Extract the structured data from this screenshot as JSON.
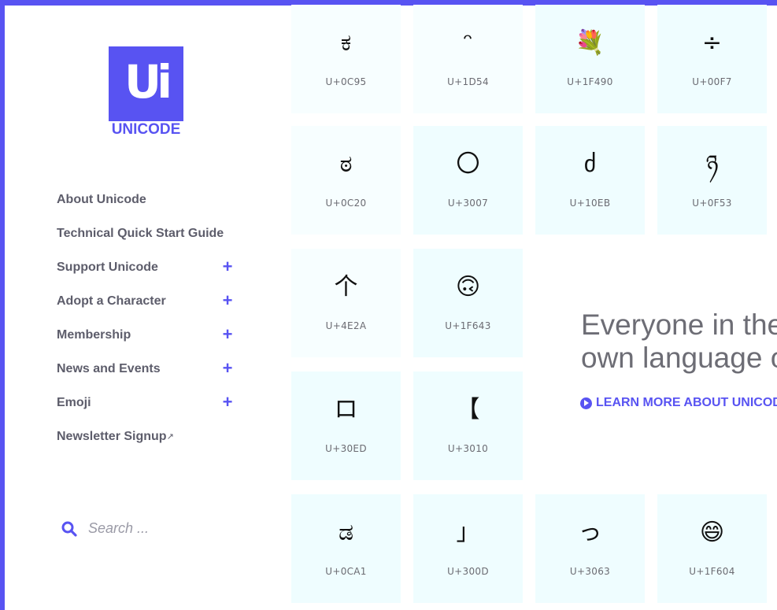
{
  "brand": {
    "name": "UNICODE",
    "logo_mark": "Ui",
    "accent_color": "#5853f2"
  },
  "nav": [
    {
      "label": "About Unicode",
      "expandable": false
    },
    {
      "label": "Technical Quick Start Guide",
      "expandable": false
    },
    {
      "label": "Support Unicode",
      "expandable": true,
      "expand_symbol": "+"
    },
    {
      "label": "Adopt a Character",
      "expandable": true,
      "expand_symbol": "+"
    },
    {
      "label": "Membership",
      "expandable": true,
      "expand_symbol": "+"
    },
    {
      "label": "News and Events",
      "expandable": true,
      "expand_symbol": "+"
    },
    {
      "label": "Emoji",
      "expandable": true,
      "expand_symbol": "+"
    },
    {
      "label": "Newsletter Signup",
      "expandable": false,
      "external_icon": "↗"
    }
  ],
  "search": {
    "placeholder": "Search ...",
    "icon": "search-icon"
  },
  "tiles": [
    {
      "glyph": "ಕ",
      "code": "U+0C95"
    },
    {
      "glyph": "ᵔ",
      "code": "U+1D54"
    },
    {
      "glyph": "💐",
      "code": "U+1F490"
    },
    {
      "glyph": "÷",
      "code": "U+00F7"
    },
    {
      "glyph": "ಠ",
      "code": "U+0C20"
    },
    {
      "glyph": "〇",
      "code": "U+3007"
    },
    {
      "glyph": "ძ",
      "code": "U+10EB"
    },
    {
      "glyph": "ཉ",
      "code": "U+0F53"
    },
    {
      "glyph": "个",
      "code": "U+4E2A"
    },
    {
      "glyph": "🙃",
      "code": "U+1F643"
    },
    {
      "glyph": "ロ",
      "code": "U+30ED"
    },
    {
      "glyph": "【",
      "code": "U+3010"
    },
    {
      "glyph": "ಡ",
      "code": "U+0CA1"
    },
    {
      "glyph": "」",
      "code": "U+300D"
    },
    {
      "glyph": "っ",
      "code": "U+3063"
    },
    {
      "glyph": "😄",
      "code": "U+1F604"
    }
  ],
  "hero": {
    "line1": "Everyone in the",
    "line2": "own language o",
    "cta_label": "LEARN MORE ABOUT UNICODE",
    "cta_icon": "play-circle-icon"
  }
}
